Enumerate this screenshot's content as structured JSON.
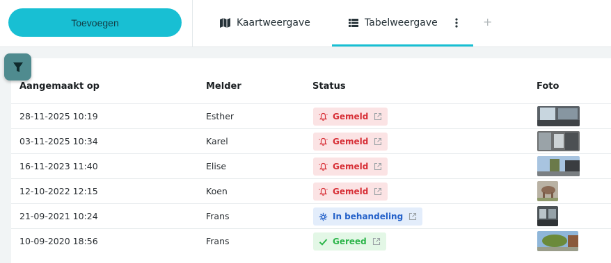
{
  "toolbar": {
    "add_label": "Toevoegen"
  },
  "tabs": [
    {
      "label": "Kaartweergave",
      "icon": "map-icon"
    },
    {
      "label": "Tabelweergave",
      "icon": "list-icon",
      "active": true
    }
  ],
  "table": {
    "headers": {
      "created": "Aangemaakt op",
      "reporter": "Melder",
      "status": "Status",
      "photo": "Foto"
    },
    "rows": [
      {
        "created": "28-11-2025 10:19",
        "reporter": "Esther",
        "status": "Gemeld",
        "status_kind": "reported"
      },
      {
        "created": "03-11-2025 10:34",
        "reporter": "Karel",
        "status": "Gemeld",
        "status_kind": "reported"
      },
      {
        "created": "16-11-2023 11:40",
        "reporter": "Elise",
        "status": "Gemeld",
        "status_kind": "reported"
      },
      {
        "created": "12-10-2022 12:15",
        "reporter": "Koen",
        "status": "Gemeld",
        "status_kind": "reported"
      },
      {
        "created": "21-09-2021 10:24",
        "reporter": "Frans",
        "status": "In behandeling",
        "status_kind": "in-progress"
      },
      {
        "created": "10-09-2020 18:56",
        "reporter": "Frans",
        "status": "Gereed",
        "status_kind": "done"
      }
    ]
  },
  "colors": {
    "accent": "#18bfd3",
    "reported": "#d72f36",
    "in_progress": "#2461c9",
    "done": "#2cb54a",
    "filter": "#4f8b8f"
  }
}
